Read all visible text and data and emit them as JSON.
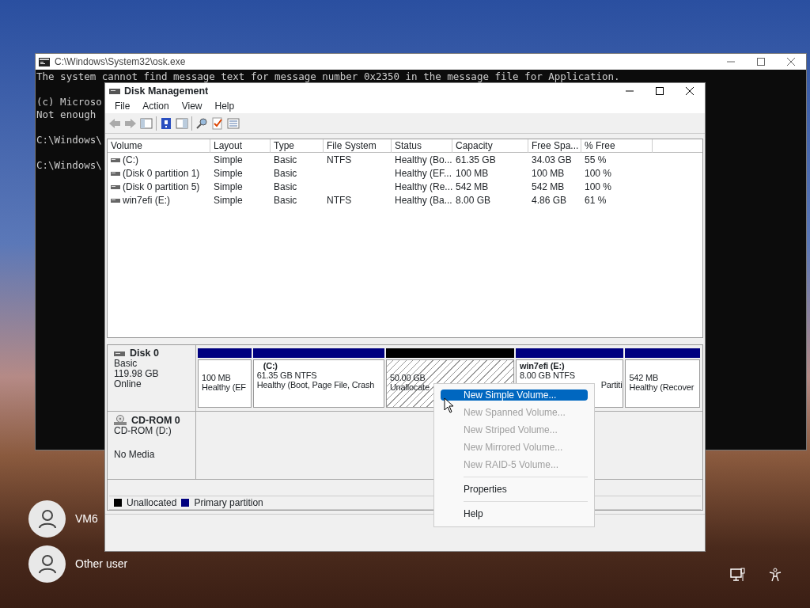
{
  "console": {
    "title": "C:\\Windows\\System32\\osk.exe",
    "paragraphs": [
      [
        "The system cannot find message text for message number 0x2350 in the message file for Application."
      ],
      [
        "(c) Microso",
        "Not enough"
      ],
      [
        "C:\\Windows\\"
      ],
      [
        "C:\\Windows\\"
      ]
    ]
  },
  "disk_management": {
    "title": "Disk Management",
    "menu": [
      "File",
      "Action",
      "View",
      "Help"
    ],
    "volume_table": {
      "columns": [
        "Volume",
        "Layout",
        "Type",
        "File System",
        "Status",
        "Capacity",
        "Free Spa...",
        "% Free"
      ],
      "rows": [
        [
          "(C:)",
          "Simple",
          "Basic",
          "NTFS",
          "Healthy (Bo...",
          "61.35 GB",
          "34.03 GB",
          "55 %"
        ],
        [
          "(Disk 0 partition 1)",
          "Simple",
          "Basic",
          "",
          "Healthy (EF...",
          "100 MB",
          "100 MB",
          "100 %"
        ],
        [
          "(Disk 0 partition 5)",
          "Simple",
          "Basic",
          "",
          "Healthy (Re...",
          "542 MB",
          "542 MB",
          "100 %"
        ],
        [
          "win7efi (E:)",
          "Simple",
          "Basic",
          "NTFS",
          "Healthy (Ba...",
          "8.00 GB",
          "4.86 GB",
          "61 %"
        ]
      ]
    },
    "disks": [
      {
        "kind": "disk",
        "name": "Disk 0",
        "type": "Basic",
        "size": "119.98 GB",
        "status": "Online",
        "partitions": [
          {
            "kind": "primary",
            "color": "#000080",
            "size": "100 MB",
            "status": "Healthy (EF"
          },
          {
            "kind": "primary",
            "color": "#000080",
            "title": "(C:)",
            "size": "61.35 GB NTFS",
            "status": "Healthy (Boot, Page File, Crash"
          },
          {
            "kind": "unallocated",
            "color": "#000000",
            "size": "50.00 GB",
            "status": "Unallocate"
          },
          {
            "kind": "primary",
            "color": "#000080",
            "title": "win7efi  (E:)",
            "size": "8.00 GB NTFS",
            "status": "Partiti"
          },
          {
            "kind": "primary",
            "color": "#000080",
            "size": "542 MB",
            "status": "Healthy (Recover"
          }
        ]
      },
      {
        "kind": "cdrom",
        "name": "CD-ROM 0",
        "type": "CD-ROM (D:)",
        "status": "No Media"
      }
    ],
    "legend": [
      {
        "label": "Unallocated",
        "color": "#000000"
      },
      {
        "label": "Primary partition",
        "color": "#000080"
      }
    ]
  },
  "context_menu": [
    {
      "kind": "item",
      "label": "New Simple Volume...",
      "selected": true,
      "disabled": false
    },
    {
      "kind": "item",
      "label": "New Spanned Volume...",
      "selected": false,
      "disabled": true
    },
    {
      "kind": "item",
      "label": "New Striped Volume...",
      "selected": false,
      "disabled": true
    },
    {
      "kind": "item",
      "label": "New Mirrored Volume...",
      "selected": false,
      "disabled": true
    },
    {
      "kind": "item",
      "label": "New RAID-5 Volume...",
      "selected": false,
      "disabled": true
    },
    {
      "kind": "separator"
    },
    {
      "kind": "item",
      "label": "Properties",
      "selected": false,
      "disabled": false
    },
    {
      "kind": "separator"
    },
    {
      "kind": "item",
      "label": "Help",
      "selected": false,
      "disabled": false
    }
  ],
  "users": [
    {
      "name": "VM6"
    },
    {
      "name": "Other user"
    }
  ]
}
